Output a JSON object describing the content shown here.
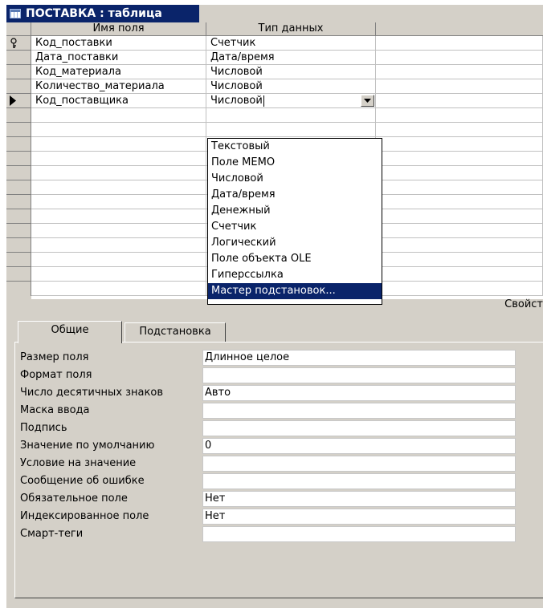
{
  "window": {
    "title": "ПОСТАВКА : таблица"
  },
  "grid": {
    "headers": {
      "field_name": "Имя поля",
      "data_type": "Тип данных"
    },
    "rows": [
      {
        "name": "Код_поставки",
        "type": "Счетчик",
        "primary_key": true
      },
      {
        "name": "Дата_поставки",
        "type": "Дата/время"
      },
      {
        "name": "Код_материала",
        "type": "Числовой"
      },
      {
        "name": "Количество_материала",
        "type": "Числовой"
      },
      {
        "name": "Код_поставщика",
        "type": "Числовой",
        "current": true
      }
    ]
  },
  "dropdown": {
    "options": [
      "Текстовый",
      "Поле МЕМО",
      "Числовой",
      "Дата/время",
      "Денежный",
      "Счетчик",
      "Логический",
      "Поле объекта OLE",
      "Гиперссылка",
      "Мастер подстановок..."
    ],
    "highlighted": "Мастер подстановок..."
  },
  "properties_label": "Свойст",
  "tabs": {
    "general": "Общие",
    "lookup": "Подстановка"
  },
  "properties": [
    {
      "label": "Размер поля",
      "value": "Длинное целое"
    },
    {
      "label": "Формат поля",
      "value": ""
    },
    {
      "label": "Число десятичных знаков",
      "value": "Авто"
    },
    {
      "label": "Маска ввода",
      "value": ""
    },
    {
      "label": "Подпись",
      "value": ""
    },
    {
      "label": "Значение по умолчанию",
      "value": "0"
    },
    {
      "label": "Условие на значение",
      "value": ""
    },
    {
      "label": "Сообщение об ошибке",
      "value": ""
    },
    {
      "label": "Обязательное поле",
      "value": "Нет"
    },
    {
      "label": "Индексированное поле",
      "value": "Нет"
    },
    {
      "label": "Смарт-теги",
      "value": ""
    }
  ],
  "colors": {
    "titlebar": "#0a246a",
    "highlight": "#0a246a",
    "face": "#d4d0c8"
  }
}
